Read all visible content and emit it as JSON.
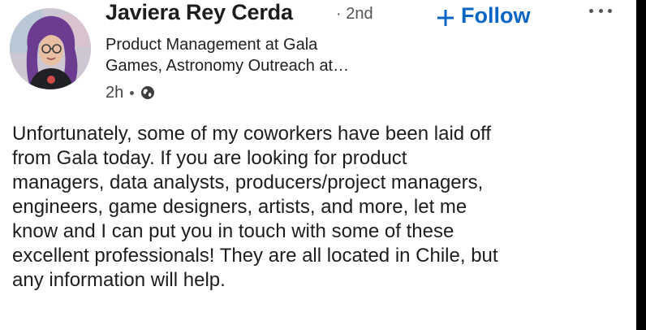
{
  "author": {
    "name": "Javiera Rey Cerda",
    "degree": "· 2nd",
    "headline_lines": [
      "Product Management at Gala",
      "Games, Astronomy Outreach at…"
    ],
    "time": "2h",
    "visibility_icon": "globe-icon"
  },
  "actions": {
    "follow_label": "Follow",
    "follow_icon": "plus-icon",
    "more_icon": "more-horizontal-icon"
  },
  "post": {
    "lines": [
      "Unfortunately, some of my coworkers have been laid off",
      "from Gala today. If you are looking for product",
      "managers, data analysts, producers/project managers,",
      "engineers, game designers, artists, and more, let me",
      "know and I can put you in touch with some of these",
      "excellent professionals! They are all located in Chile, but",
      "any information will help."
    ]
  },
  "colors": {
    "accent": "#0a66c2",
    "text": "#1d1d1d",
    "muted": "#555555",
    "background": "#ffffff"
  }
}
